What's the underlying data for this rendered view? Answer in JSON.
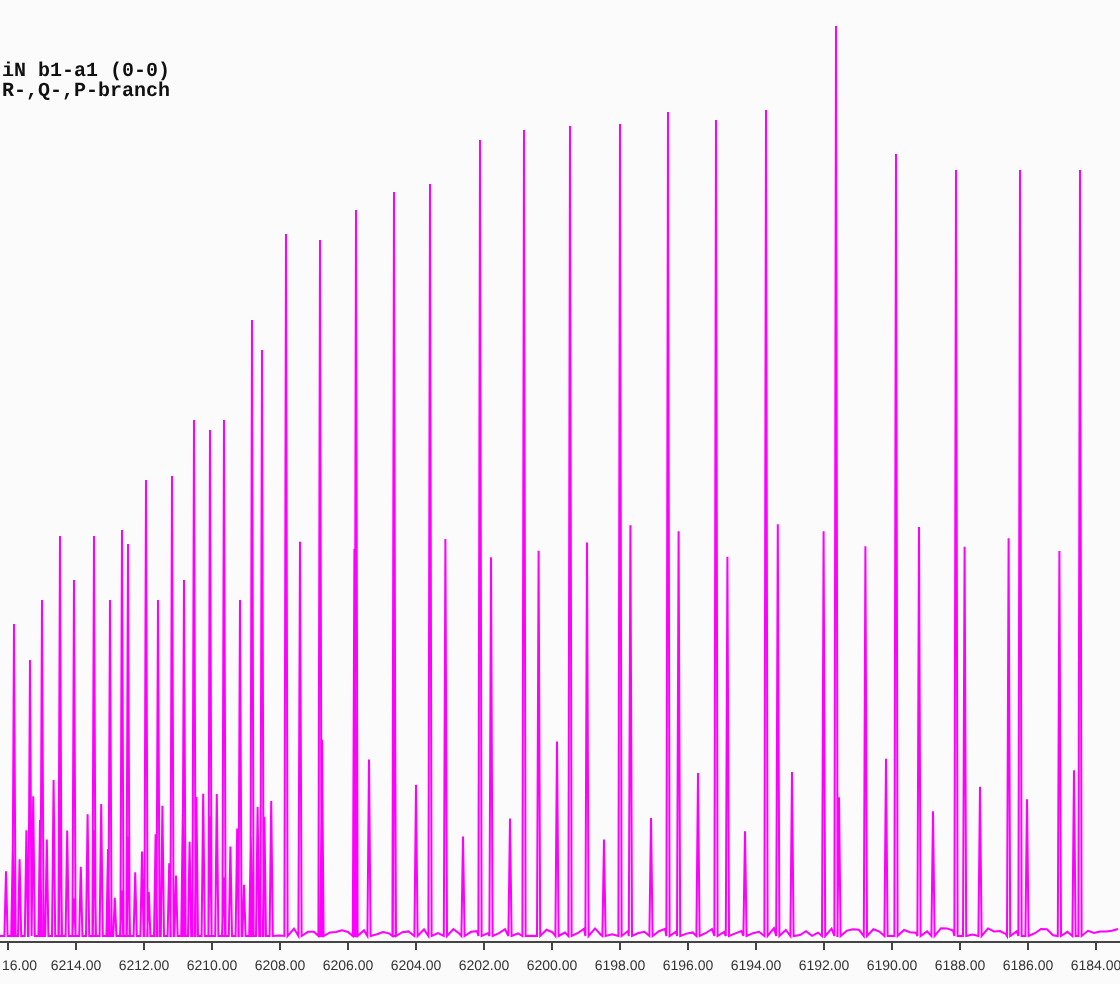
{
  "plot": {
    "title_lines": [
      "iN b1-a1 (0-0)",
      "R-,Q-,P-branch"
    ],
    "x_axis": {
      "tick_labels": [
        "16.00",
        "6214.00",
        "6212.00",
        "6210.00",
        "6208.00",
        "6206.00",
        "6204.00",
        "6202.00",
        "6200.00",
        "6198.00",
        "6196.00",
        "6194.00",
        "6192.00",
        "6190.00",
        "6188.00",
        "6186.00",
        "6184.00"
      ]
    }
  }
}
